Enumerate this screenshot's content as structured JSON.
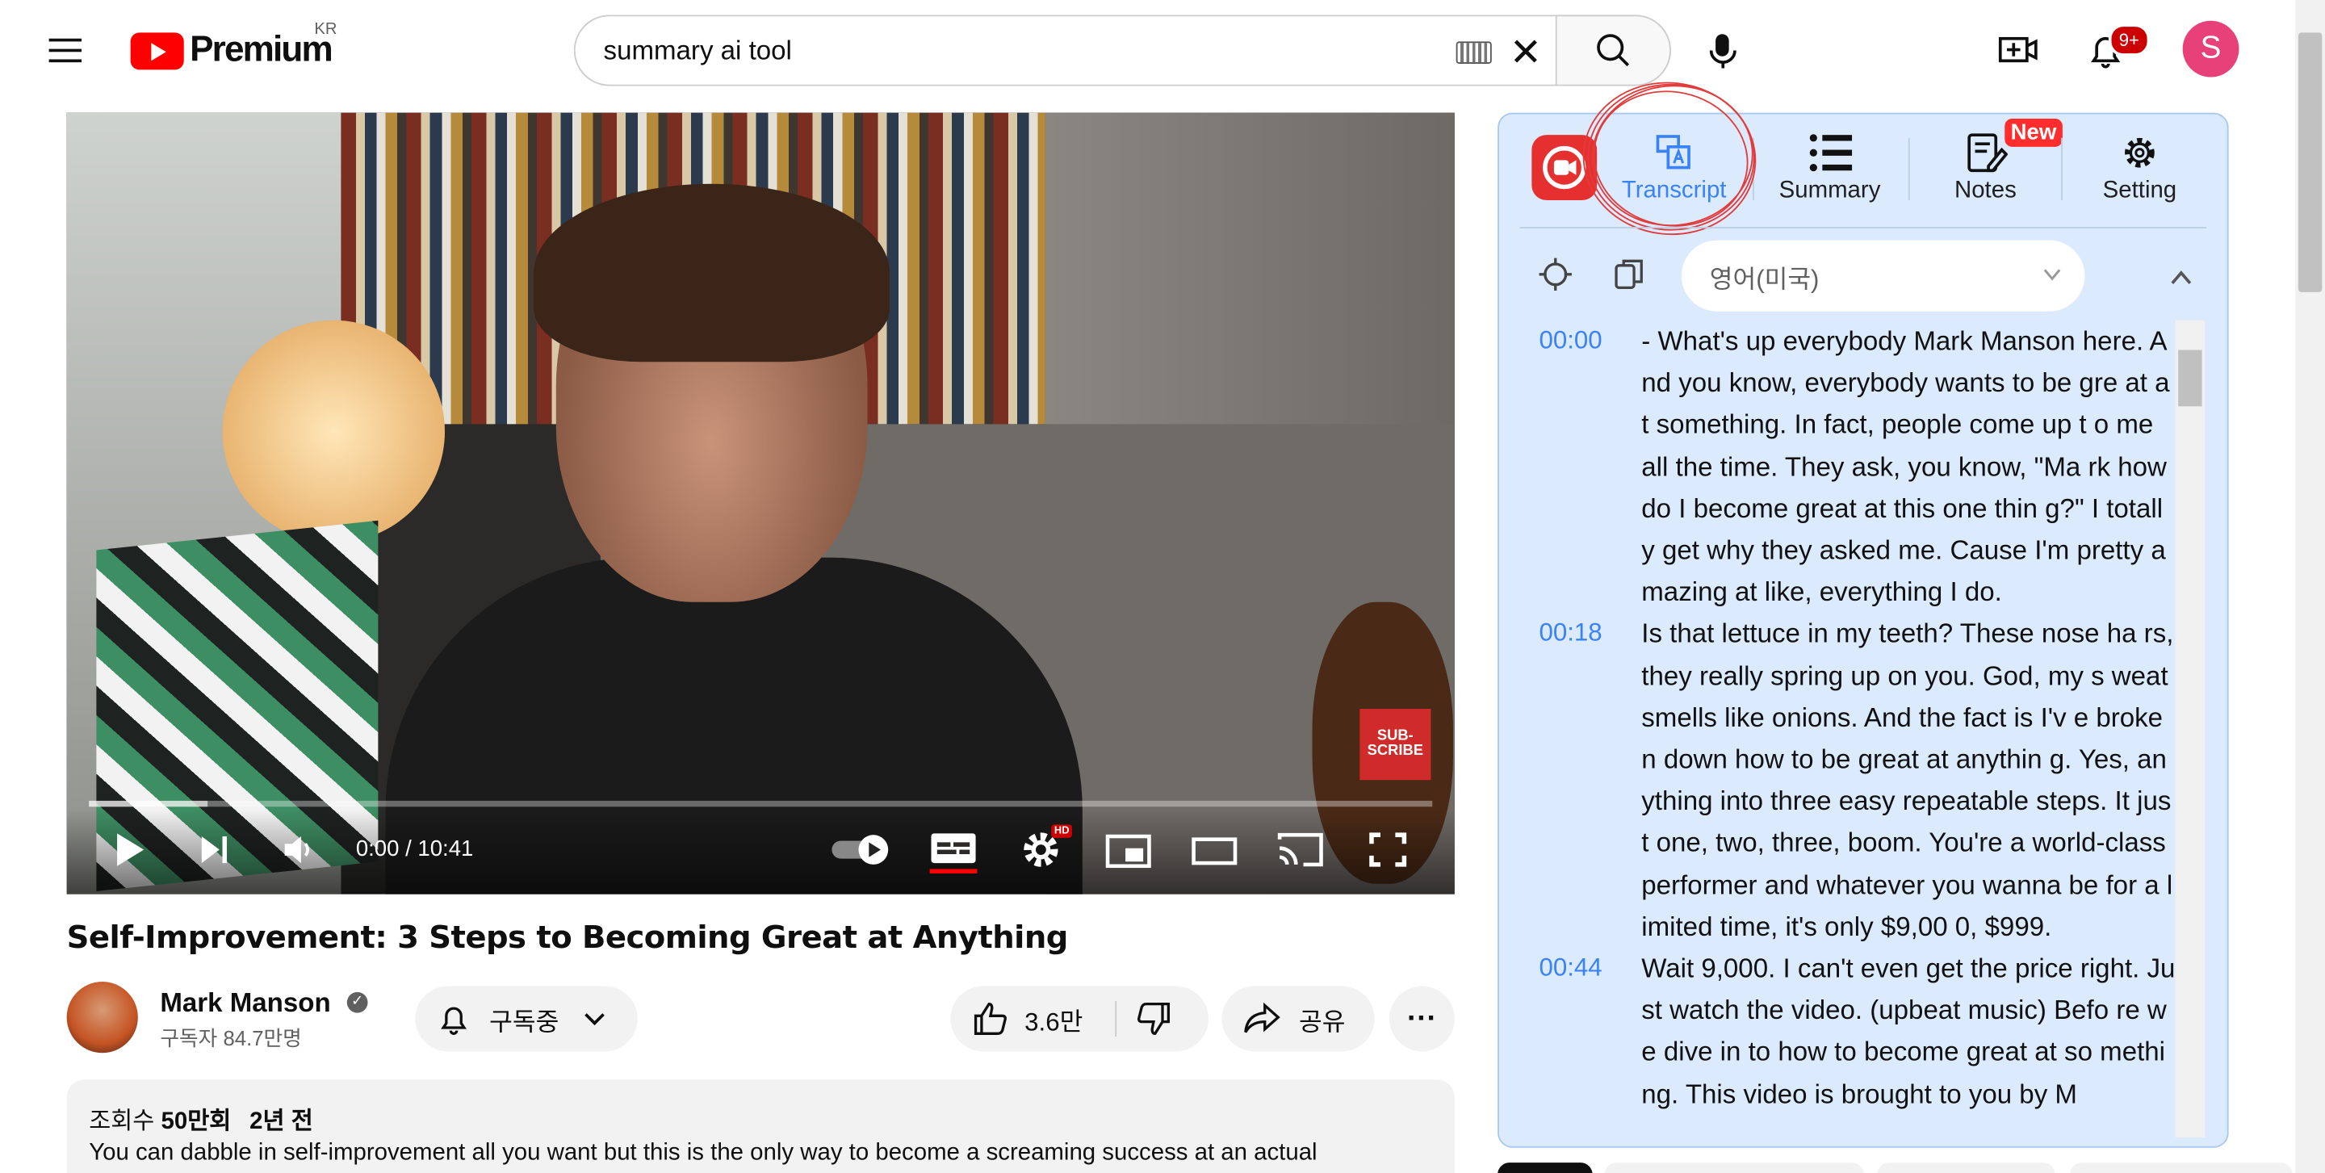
{
  "header": {
    "logo_text": "Premium",
    "region": "KR",
    "search_value": "summary ai tool",
    "notification_count": "9+",
    "avatar_letter": "S"
  },
  "player": {
    "time": "0:00 / 10:41",
    "hd_label": "HD",
    "subscribe_overlay": "SUB-\nSCRIBE",
    "progress_fraction": 0.0
  },
  "video": {
    "title": "Self-Improvement: 3 Steps to Becoming Great at Anything",
    "channel": "Mark Manson",
    "subscribers": "구독자 84.7만명",
    "subscribe_label": "구독중",
    "likes": "3.6만",
    "share_label": "공유",
    "views": "50만회",
    "views_prefix": "조회수",
    "age": "2년 전",
    "description": "You can dabble in self-improvement all you want but this is the only way to become a screaming success at an actual"
  },
  "extension": {
    "tabs": [
      {
        "label": "Transcript",
        "icon": "transcript-icon",
        "active": true
      },
      {
        "label": "Summary",
        "icon": "list-icon",
        "active": false
      },
      {
        "label": "Notes",
        "icon": "notes-icon",
        "active": false,
        "badge": "New"
      },
      {
        "label": "Setting",
        "icon": "gear-icon",
        "active": false
      }
    ],
    "language": "영어(미국)",
    "accent_color": "#3a82f7",
    "transcript": [
      {
        "time": "00:00",
        "text": "- What's up everybody Mark Manson here. And you know, everybody wants to be gre at at something. In fact, people come up t o me all the time. They ask, you know, \"Ma rk how do I become great at this one thin g?\" I totally get why they asked me. Cause I'm pretty amazing at like, everything I do."
      },
      {
        "time": "00:18",
        "text": "Is that lettuce in my teeth? These nose ha rs, they really spring up on you. God, my s weat smells like onions. And the fact is I'v e broken down how to be great at anythin g. Yes, anything into three easy repeatable steps. It just one, two, three, boom. You're a world-class performer and whatever you wanna be for a limited time, it's only $9,00 0, $999."
      },
      {
        "time": "00:44",
        "text": "Wait 9,000. I can't even get the price right. Just watch the video. (upbeat music) Befo re we dive in to how to become great at so mething. This video is brought to you by M"
      }
    ]
  }
}
